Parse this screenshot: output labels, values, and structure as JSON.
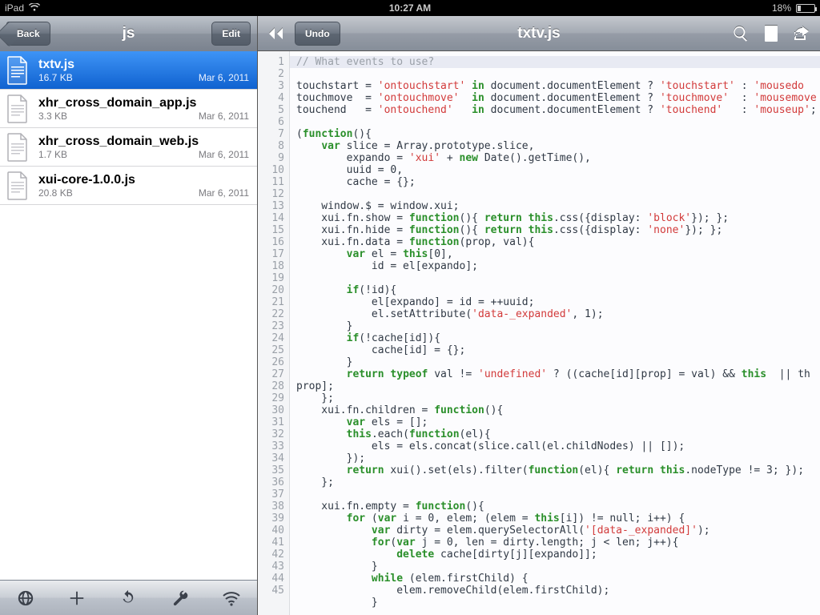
{
  "statusbar": {
    "device": "iPad",
    "time": "10:27 AM",
    "battery_pct": "18%"
  },
  "sidebar": {
    "back_label": "Back",
    "edit_label": "Edit",
    "title": "js",
    "files": [
      {
        "name": "txtv.js",
        "size": "16.7 KB",
        "date": "Mar 6, 2011",
        "selected": true
      },
      {
        "name": "xhr_cross_domain_app.js",
        "size": "3.3 KB",
        "date": "Mar 6, 2011",
        "selected": false
      },
      {
        "name": "xhr_cross_domain_web.js",
        "size": "1.7 KB",
        "date": "Mar 6, 2011",
        "selected": false
      },
      {
        "name": "xui-core-1.0.0.js",
        "size": "20.8 KB",
        "date": "Mar 6, 2011",
        "selected": false
      }
    ],
    "toolbar_icons": [
      "globe-icon",
      "add-icon",
      "refresh-icon",
      "wrench-icon",
      "wifi-icon"
    ]
  },
  "editor": {
    "undo_label": "Undo",
    "title": "txtv.js",
    "nav_icons": {
      "history": "history-back-icon",
      "search": "search-icon",
      "doc": "document-icon",
      "share": "share-icon"
    },
    "line_start": 1,
    "line_end": 45,
    "code_lines": [
      {
        "t": "comment",
        "text": "// What events to use?",
        "hl": true
      },
      {
        "t": "plain",
        "text": "touchstart = |s|'ontouchstart'|/| |k|in|/| document.documentElement ? |s|'touchstart'|/| : |s|'mousedo|/|"
      },
      {
        "t": "plain",
        "text": "touchmove  = |s|'ontouchmove'|/|  |k|in|/| document.documentElement ? |s|'touchmove'|/|  : |s|'mousemove|/|"
      },
      {
        "t": "plain",
        "text": "touchend   = |s|'ontouchend'|/|   |k|in|/| document.documentElement ? |s|'touchend'|/|   : |s|'mouseup'|/|;"
      },
      {
        "t": "plain",
        "text": ""
      },
      {
        "t": "plain",
        "text": "(|k|function|/|(){"
      },
      {
        "t": "plain",
        "text": "    |k|var|/| slice = Array.prototype.slice,"
      },
      {
        "t": "plain",
        "text": "        expando = |s|'xui'|/| + |k|new|/| Date().getTime(),"
      },
      {
        "t": "plain",
        "text": "        uuid = 0,"
      },
      {
        "t": "plain",
        "text": "        cache = {};"
      },
      {
        "t": "plain",
        "text": ""
      },
      {
        "t": "plain",
        "text": "    window.$ = window.xui;"
      },
      {
        "t": "plain",
        "text": "    xui.fn.show = |k|function|/|(){ |k|return|/| |k|this|/|.css({display: |s|'block'|/|}); };"
      },
      {
        "t": "plain",
        "text": "    xui.fn.hide = |k|function|/|(){ |k|return|/| |k|this|/|.css({display: |s|'none'|/|}); };"
      },
      {
        "t": "plain",
        "text": "    xui.fn.data = |k|function|/|(prop, val){"
      },
      {
        "t": "plain",
        "text": "        |k|var|/| el = |k|this|/|[0],"
      },
      {
        "t": "plain",
        "text": "            id = el[expando];"
      },
      {
        "t": "plain",
        "text": ""
      },
      {
        "t": "plain",
        "text": "        |k|if|/|(!id){"
      },
      {
        "t": "plain",
        "text": "            el[expando] = id = ++uuid;"
      },
      {
        "t": "plain",
        "text": "            el.setAttribute(|s|'data-_expanded'|/|, 1);"
      },
      {
        "t": "plain",
        "text": "        }"
      },
      {
        "t": "plain",
        "text": "        |k|if|/|(!cache[id]){"
      },
      {
        "t": "plain",
        "text": "            cache[id] = {};"
      },
      {
        "t": "plain",
        "text": "        }"
      },
      {
        "t": "plain",
        "text": "        |k|return|/| |k|typeof|/| val != |s|'undefined'|/| ? ((cache[id][prop] = val) && |k|this|/|  || th"
      },
      {
        "t": "plain",
        "text": "prop];"
      },
      {
        "t": "plain",
        "text": "    };"
      },
      {
        "t": "plain",
        "text": "    xui.fn.children = |k|function|/|(){"
      },
      {
        "t": "plain",
        "text": "        |k|var|/| els = [];"
      },
      {
        "t": "plain",
        "text": "        |k|this|/|.each(|k|function|/|(el){"
      },
      {
        "t": "plain",
        "text": "            els = els.concat(slice.call(el.childNodes) || []);"
      },
      {
        "t": "plain",
        "text": "        });"
      },
      {
        "t": "plain",
        "text": "        |k|return|/| xui().set(els).filter(|k|function|/|(el){ |k|return|/| |k|this|/|.nodeType != 3; });"
      },
      {
        "t": "plain",
        "text": "    };"
      },
      {
        "t": "plain",
        "text": ""
      },
      {
        "t": "plain",
        "text": "    xui.fn.empty = |k|function|/|(){"
      },
      {
        "t": "plain",
        "text": "        |k|for|/| (|k|var|/| i = 0, elem; (elem = |k|this|/|[i]) != null; i++) {"
      },
      {
        "t": "plain",
        "text": "            |k|var|/| dirty = elem.querySelectorAll(|s|'[data-_expanded]'|/|);"
      },
      {
        "t": "plain",
        "text": "            |k|for|/|(|k|var|/| j = 0, len = dirty.length; j < len; j++){"
      },
      {
        "t": "plain",
        "text": "                |k|delete|/| cache[dirty[j][expando]];"
      },
      {
        "t": "plain",
        "text": "            }"
      },
      {
        "t": "plain",
        "text": "            |k|while|/| (elem.firstChild) {"
      },
      {
        "t": "plain",
        "text": "                elem.removeChild(elem.firstChild);"
      },
      {
        "t": "plain",
        "text": "            }"
      }
    ]
  }
}
